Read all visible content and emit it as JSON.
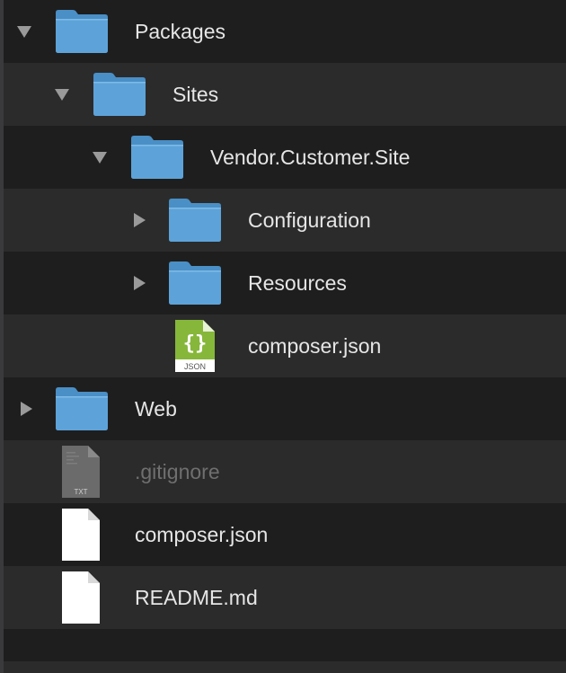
{
  "file_list": {
    "items": [
      {
        "label": "Packages",
        "kind": "folder",
        "depth": 0,
        "disclosure": "expanded"
      },
      {
        "label": "Sites",
        "kind": "folder",
        "depth": 1,
        "disclosure": "expanded"
      },
      {
        "label": "Vendor.Customer.Site",
        "kind": "folder",
        "depth": 2,
        "disclosure": "expanded"
      },
      {
        "label": "Configuration",
        "kind": "folder",
        "depth": 3,
        "disclosure": "collapsed"
      },
      {
        "label": "Resources",
        "kind": "folder",
        "depth": 3,
        "disclosure": "collapsed"
      },
      {
        "label": "composer.json",
        "kind": "json-file",
        "depth": 3,
        "disclosure": "none",
        "icon_badge": "JSON",
        "icon_glyph": "{}"
      },
      {
        "label": "Web",
        "kind": "folder",
        "depth": 0,
        "disclosure": "collapsed"
      },
      {
        "label": ".gitignore",
        "kind": "text-file",
        "depth": 0,
        "disclosure": "none",
        "icon_badge": "TXT",
        "dimmed": true
      },
      {
        "label": "composer.json",
        "kind": "blank-file",
        "depth": 0,
        "disclosure": "none"
      },
      {
        "label": "README.md",
        "kind": "blank-file",
        "depth": 0,
        "disclosure": "none"
      }
    ]
  },
  "colors": {
    "folder_fill": "#5da3d9",
    "json_icon": "#86b73a",
    "text": "#e6e6e6",
    "dim_text": "#6f6f6f",
    "row_light": "#2b2b2b",
    "row_dark": "#1e1e1e"
  },
  "icons": {
    "folder": "folder-icon",
    "json": "json-file-icon",
    "text": "text-file-icon",
    "blank": "document-icon",
    "expanded": "disclosure-triangle-down-icon",
    "collapsed": "disclosure-triangle-right-icon"
  }
}
